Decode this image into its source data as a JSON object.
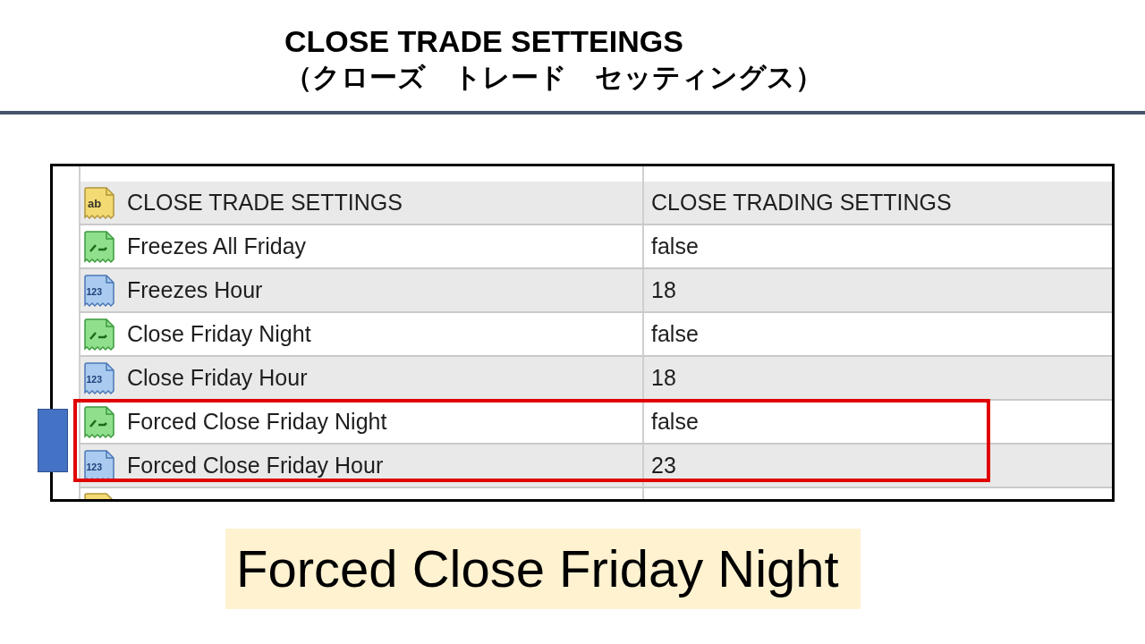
{
  "header": {
    "title": "CLOSE TRADE SETTEINGS",
    "subtitle": "（クローズ　トレード　セッティングス）"
  },
  "table": {
    "group": {
      "kind": "text",
      "icon_label": "ab",
      "name": "CLOSE TRADE SETTINGS",
      "value": "CLOSE TRADING SETTINGS"
    },
    "rows": [
      {
        "kind": "bool",
        "name": "Freezes All Friday",
        "value": "false",
        "highlighted": false
      },
      {
        "kind": "number",
        "icon_label": "123",
        "name": "Freezes Hour",
        "value": "18",
        "highlighted": false
      },
      {
        "kind": "bool",
        "name": "Close Friday Night",
        "value": "false",
        "highlighted": false
      },
      {
        "kind": "number",
        "icon_label": "123",
        "name": "Close Friday Hour",
        "value": "18",
        "highlighted": false
      },
      {
        "kind": "bool",
        "name": "Forced Close Friday Night",
        "value": "false",
        "highlighted": true
      },
      {
        "kind": "number",
        "icon_label": "123",
        "name": "Forced Close Friday Hour",
        "value": "23",
        "highlighted": true
      }
    ],
    "partial_row": {
      "kind": "text"
    }
  },
  "caption": "Forced Close Friday Night"
}
